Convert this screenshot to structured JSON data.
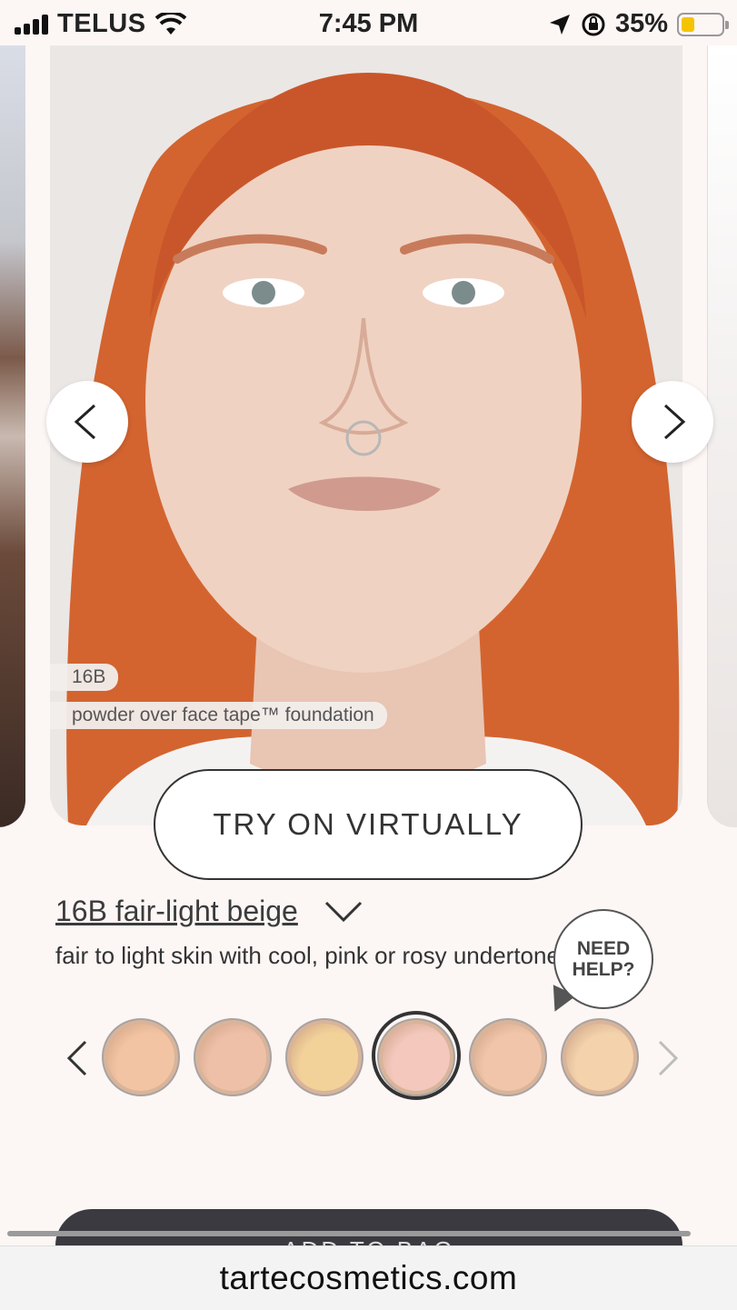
{
  "status_bar": {
    "carrier": "TELUS",
    "time": "7:45 PM",
    "battery_percent": "35%",
    "battery_level": 0.35,
    "icons": [
      "signal-icon",
      "wifi-icon",
      "location-icon",
      "orientation-lock-icon",
      "battery-icon"
    ]
  },
  "carousel": {
    "prev_icon": "chevron-left-icon",
    "next_icon": "chevron-right-icon",
    "shade_chip": "16B",
    "product_chip": "powder over face tape™ foundation"
  },
  "try_on_label": "TRY ON VIRTUALLY",
  "shade": {
    "name": "16B fair-light beige",
    "description": "fair to light skin with cool, pink or rosy undertones",
    "dropdown_icon": "chevron-down-icon"
  },
  "help": {
    "label_line1": "NEED",
    "label_line2": "HELP?"
  },
  "swatches": {
    "colors": [
      "#f2c4a3",
      "#efc0a8",
      "#f3d29a",
      "#f4c8bd",
      "#f0c5aa",
      "#f3d2ac"
    ],
    "selected_index": 3
  },
  "add_to_bag_label": "ADD TO BAG",
  "browser": {
    "url": "tartecosmetics.com"
  }
}
